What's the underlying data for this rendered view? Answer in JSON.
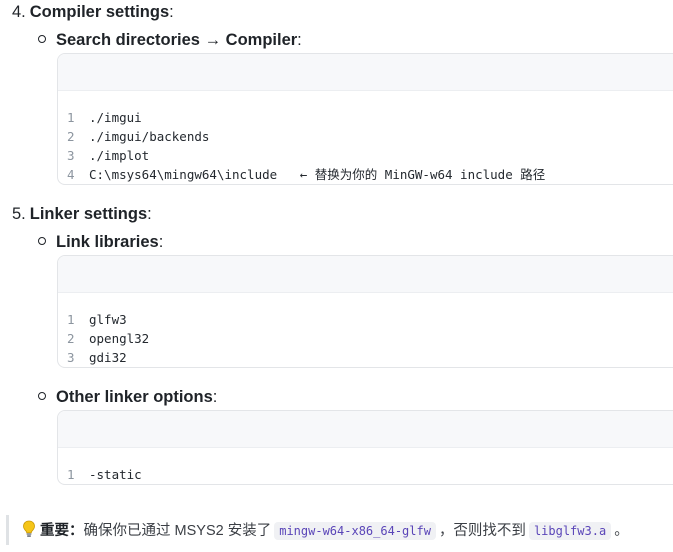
{
  "steps": [
    {
      "number": "4.",
      "title": "Compiler settings",
      "suffix": ":",
      "subitems": [
        {
          "label": "Search directories → Compiler",
          "suffix": ":",
          "code": [
            {
              "n": "1",
              "text": "./imgui"
            },
            {
              "n": "2",
              "text": "./imgui/backends"
            },
            {
              "n": "3",
              "text": "./implot"
            },
            {
              "n": "4",
              "text": "C:\\msys64\\mingw64\\include   ← 替换为你的 MinGW-w64 include 路径"
            }
          ]
        }
      ]
    },
    {
      "number": "5.",
      "title": "Linker settings",
      "suffix": ":",
      "subitems": [
        {
          "label": "Link libraries",
          "suffix": ":",
          "code": [
            {
              "n": "1",
              "text": "glfw3"
            },
            {
              "n": "2",
              "text": "opengl32"
            },
            {
              "n": "3",
              "text": "gdi32"
            }
          ]
        },
        {
          "label": "Other linker options",
          "suffix": ":",
          "code": [
            {
              "n": "1",
              "text": "-static"
            }
          ]
        }
      ]
    }
  ],
  "tip": {
    "icon": "lightbulb-icon",
    "strong": "重要",
    "colon": "：",
    "text_1": "确保你已通过 MSYS2 安装了",
    "code_1": "mingw-w64-x86_64-glfw",
    "text_2": "，否则找不到",
    "code_2": "libglfw3.a",
    "text_3": "。"
  }
}
